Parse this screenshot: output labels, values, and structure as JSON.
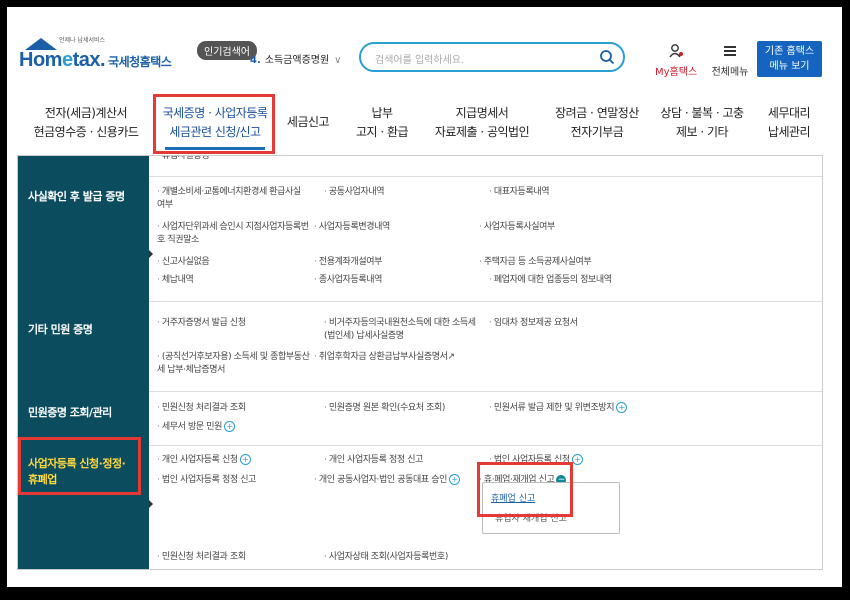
{
  "logo": {
    "tagline": "언제나 납세서비스",
    "home": "Hom",
    "e": "e",
    "tax": "tax.",
    "sub": "국세청홈택스"
  },
  "popular": {
    "badge": "인기검색어",
    "num": "4.",
    "term": "소득금액증명원"
  },
  "search": {
    "placeholder": "검색어를 입력하세요."
  },
  "header": {
    "my_label": "My홈택스",
    "all_menu": "전체메뉴",
    "old_line1": "기존 홈택스",
    "old_line2": "메뉴 보기"
  },
  "nav": [
    {
      "l1": "전자(세금)계산서",
      "l2": "현금영수증 · 신용카드"
    },
    {
      "l1": "국세증명 · 사업자등록",
      "l2": "세금관련 신청/신고"
    },
    {
      "l1": "세금신고",
      "l2": ""
    },
    {
      "l1": "납부",
      "l2": "고지 · 환급"
    },
    {
      "l1": "지급명세서",
      "l2": "자료제출 · 공익법인"
    },
    {
      "l1": "장려금 · 연말정산",
      "l2": "전자기부금"
    },
    {
      "l1": "상담 · 불복 · 고충",
      "l2": "제보 · 기타"
    },
    {
      "l1": "세무대리",
      "l2": "납세관리"
    }
  ],
  "top_partial": "휴업사실증명",
  "sections": {
    "fact": {
      "title": "사실확인 후 발급 증명",
      "items": [
        "개별소비세·교통에너지환경세 환급사실 여부",
        "공동사업자내역",
        "대표자등록내역",
        "사업자단위과세 승인시 지점사업자등록번호 직권말소",
        "사업자등록변경내역",
        "사업자등록사실여부",
        "신고사실없음",
        "전용계좌개설여부",
        "주택자금 등 소득공제사실여부",
        "체납내역",
        "종사업자등록내역",
        "폐업자에 대한 업종등의 정보내역"
      ]
    },
    "etc": {
      "title": "기타 민원 증명",
      "items": [
        "거주자증명서 발급 신청",
        "비거주자등의국내원천소득에 대한 소득세(법인세) 납세사실증명",
        "임대차 정보제공 요청서",
        "(공직선거후보자용) 소득세 및 종합부동산세 납부·체납증명서",
        "취업후학자금 상환금납부사실증명서"
      ]
    },
    "inquiry": {
      "title": "민원증명 조회/관리",
      "items": [
        "민원신청 처리결과 조회",
        "민원증명 원본 확인(수요처 조회)",
        "민원서류 발급 제한 및 위변조방지",
        "세무서 방문 민원"
      ]
    },
    "biz": {
      "title_l1": "사업자등록 신청·정정·",
      "title_l2": "휴폐업",
      "items": [
        "개인 사업자등록 신청",
        "개인 사업자등록 정정 신고",
        "법인 사업자등록 신청",
        "법인 사업자등록 정정 신고",
        "개인 공동사업자·법인 공동대표 승인",
        "휴·폐업·재개업 신고",
        "민원신청 처리결과 조회",
        "사업자상태 조회(사업자등록번호)"
      ],
      "submenu": [
        "휴폐업 신고",
        "휴업자 재개업 신고"
      ]
    }
  },
  "colors": {
    "accent": "#1a5fa8",
    "section_bg": "#0b4d5e",
    "highlight": "#e53935",
    "title_highlight": "#ffd740"
  }
}
